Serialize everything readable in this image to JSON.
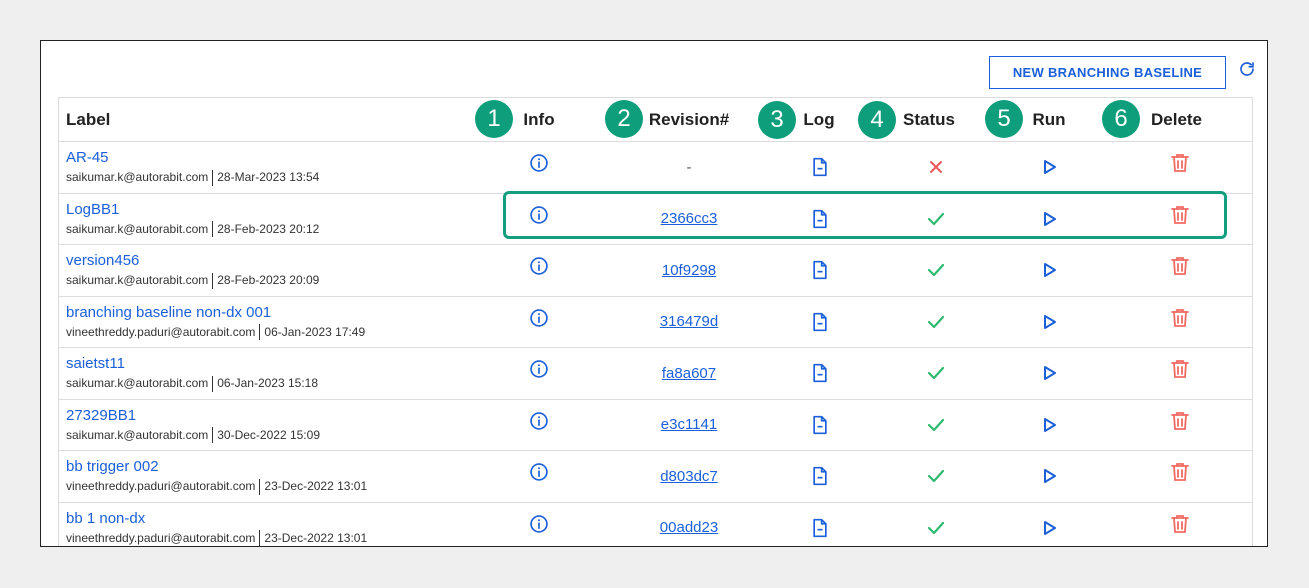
{
  "toolbar": {
    "new_button_label": "NEW BRANCHING BASELINE"
  },
  "badges": [
    "1",
    "2",
    "3",
    "4",
    "5",
    "6"
  ],
  "columns": {
    "label": "Label",
    "info": "Info",
    "revision": "Revision#",
    "log": "Log",
    "status": "Status",
    "run": "Run",
    "delete": "Delete"
  },
  "rows": [
    {
      "label": "AR-45",
      "user": "saikumar.k@autorabit.com",
      "date": "28-Mar-2023 13:54",
      "revision": "-",
      "status": "failed"
    },
    {
      "label": "LogBB1",
      "user": "saikumar.k@autorabit.com",
      "date": "28-Feb-2023 20:12",
      "revision": "2366cc3",
      "status": "success"
    },
    {
      "label": "version456",
      "user": "saikumar.k@autorabit.com",
      "date": "28-Feb-2023 20:09",
      "revision": "10f9298",
      "status": "success"
    },
    {
      "label": "branching baseline non-dx 001",
      "user": "vineethreddy.paduri@autorabit.com",
      "date": "06-Jan-2023 17:49",
      "revision": "316479d",
      "status": "success"
    },
    {
      "label": "saietst11",
      "user": "saikumar.k@autorabit.com",
      "date": "06-Jan-2023 15:18",
      "revision": "fa8a607",
      "status": "success"
    },
    {
      "label": "27329BB1",
      "user": "saikumar.k@autorabit.com",
      "date": "30-Dec-2022 15:09",
      "revision": "e3c1141",
      "status": "success"
    },
    {
      "label": "bb trigger 002",
      "user": "vineethreddy.paduri@autorabit.com",
      "date": "23-Dec-2022 13:01",
      "revision": "d803dc7",
      "status": "success"
    },
    {
      "label": "bb 1 non-dx",
      "user": "vineethreddy.paduri@autorabit.com",
      "date": "23-Dec-2022 13:01",
      "revision": "00add23",
      "status": "success"
    }
  ],
  "colors": {
    "accent": "#1b5fd9",
    "badge": "#0e9e7b",
    "success": "#2dba6e",
    "failed": "#e85c5c",
    "delete": "#ef6b63"
  }
}
